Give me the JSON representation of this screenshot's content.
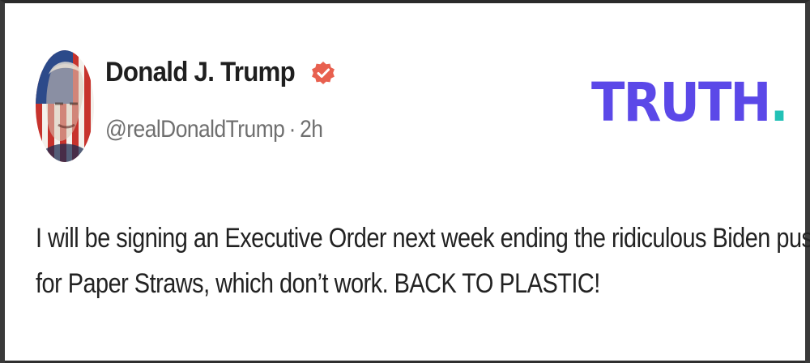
{
  "post": {
    "author": {
      "display_name": "Donald J. Trump",
      "handle": "@realDonaldTrump",
      "separator": "·",
      "time_ago": "2h",
      "verified_icon": "verified-badge-icon",
      "avatar": "profile-avatar"
    },
    "platform_logo": {
      "text": "TRUTH",
      "dot": ".",
      "text_color": "#5b48e8",
      "dot_color": "#22c1b6"
    },
    "body_lines": [
      "I will be signing an Executive Order next week ending the ridiculous Biden push",
      "for Paper Straws, which don’t work. BACK TO PLASTIC!"
    ]
  },
  "colors": {
    "verified_badge": "#e8604f"
  }
}
